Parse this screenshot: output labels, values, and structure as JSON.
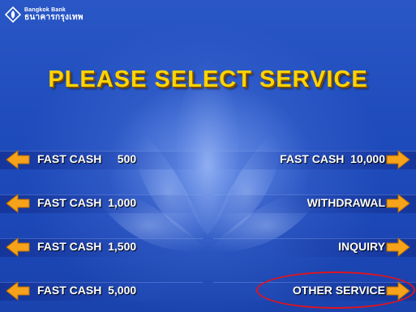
{
  "brand": {
    "name_en": "Bangkok Bank",
    "name_th": "ธนาคารกรุงเทพ"
  },
  "screen": {
    "title": "PLEASE  SELECT  SERVICE"
  },
  "left_buttons": [
    {
      "label": "FAST CASH     500"
    },
    {
      "label": "FAST CASH  1,000"
    },
    {
      "label": "FAST CASH  1,500"
    },
    {
      "label": "FAST CASH  5,000"
    }
  ],
  "right_buttons": [
    {
      "label": "FAST CASH  10,000"
    },
    {
      "label": "WITHDRAWAL"
    },
    {
      "label": "INQUIRY"
    },
    {
      "label": "OTHER SERVICE"
    }
  ],
  "colors": {
    "background": "#1f4cbc",
    "title": "#ffd400",
    "arrow": "#f6a21a",
    "highlight": "#e0141e"
  },
  "icons": {
    "logo": "bangkok-bank-lotus-logo",
    "left_arrow": "orange-arrow-left-icon",
    "right_arrow": "orange-arrow-right-icon"
  }
}
